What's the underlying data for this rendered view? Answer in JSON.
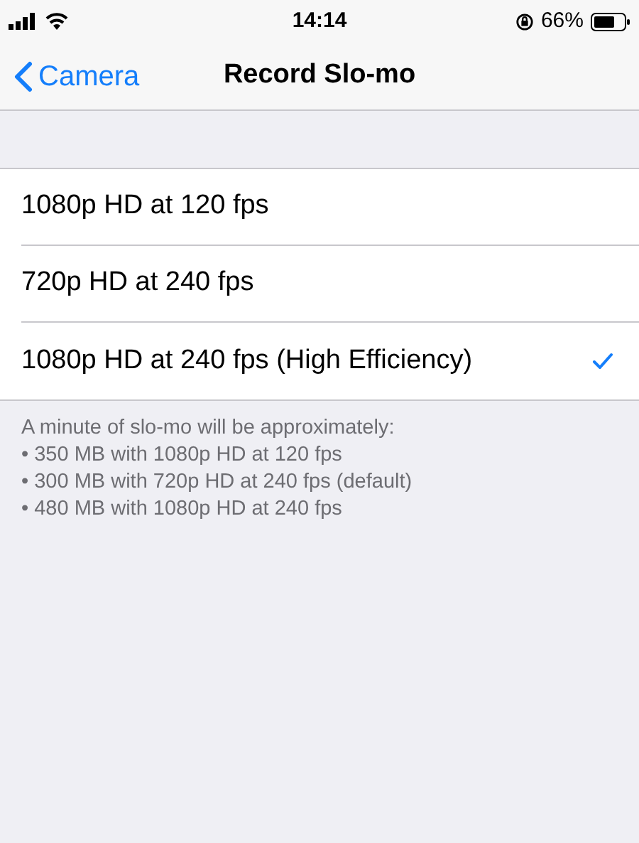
{
  "status_bar": {
    "time": "14:14",
    "battery": "66%"
  },
  "nav": {
    "back": "Camera",
    "title": "Record Slo-mo"
  },
  "options": [
    {
      "label": "1080p HD at 120 fps",
      "selected": false
    },
    {
      "label": "720p HD at 240 fps",
      "selected": false
    },
    {
      "label": "1080p HD at 240 fps (High Efficiency)",
      "selected": true
    }
  ],
  "footer": [
    "A minute of slo-mo will be approximately:",
    "• 350 MB with 1080p HD at 120 fps",
    "• 300 MB with 720p HD at 240 fps (default)",
    "• 480 MB with 1080p HD at 240 fps"
  ]
}
